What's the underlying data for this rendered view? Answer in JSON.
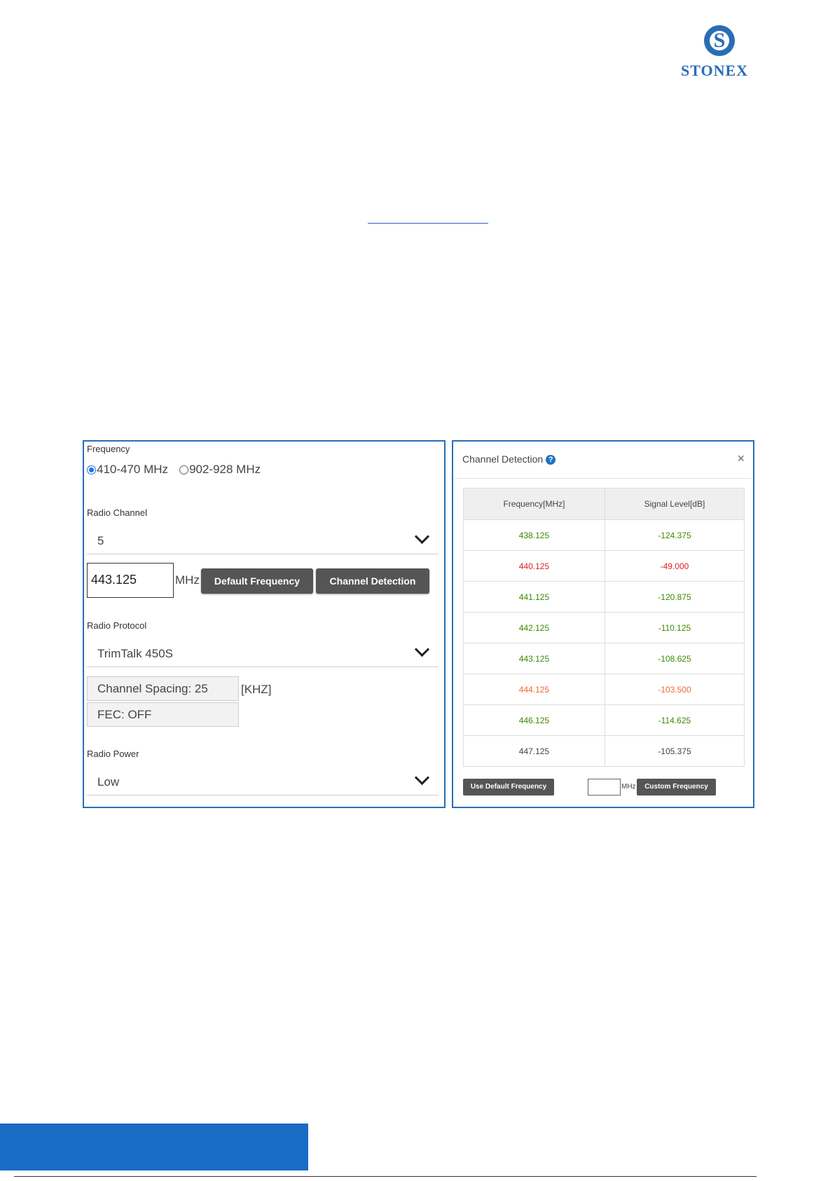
{
  "logo": {
    "text": "STONEX",
    "mark": "S"
  },
  "left_panel": {
    "frequency_label": "Frequency",
    "band_options": [
      {
        "label": "410-470 MHz",
        "checked": true
      },
      {
        "label": "902-928 MHz",
        "checked": false
      }
    ],
    "radio_channel_label": "Radio Channel",
    "radio_channel_value": "5",
    "frequency_value": "443.125",
    "mhz_unit": "MHz",
    "default_frequency_button": "Default Frequency",
    "channel_detection_button": "Channel Detection",
    "radio_protocol_label": "Radio Protocol",
    "radio_protocol_value": "TrimTalk 450S",
    "channel_spacing": "Channel Spacing: 25",
    "khz_unit": "[KHZ]",
    "fec": "FEC: OFF",
    "radio_power_label": "Radio Power",
    "radio_power_value": "Low"
  },
  "right_panel": {
    "title": "Channel Detection",
    "help_icon": "?",
    "close_icon": "×",
    "columns": [
      "Frequency[MHz]",
      "Signal Level[dB]"
    ],
    "rows": [
      {
        "freq": "438.125",
        "level": "-124.375",
        "color": "#3d8a00"
      },
      {
        "freq": "440.125",
        "level": "-49.000",
        "color": "#e02020"
      },
      {
        "freq": "441.125",
        "level": "-120.875",
        "color": "#3d8a00"
      },
      {
        "freq": "442.125",
        "level": "-110.125",
        "color": "#3d8a00"
      },
      {
        "freq": "443.125",
        "level": "-108.625",
        "color": "#3d8a00"
      },
      {
        "freq": "444.125",
        "level": "-103.500",
        "color": "#f06a30"
      },
      {
        "freq": "446.125",
        "level": "-114.625",
        "color": "#3d8a00"
      },
      {
        "freq": "447.125",
        "level": "-105.375",
        "color": "#444444"
      }
    ],
    "use_default_button": "Use Default Frequency",
    "mhz_unit": "MHz",
    "custom_frequency_button": "Custom Frequency"
  }
}
